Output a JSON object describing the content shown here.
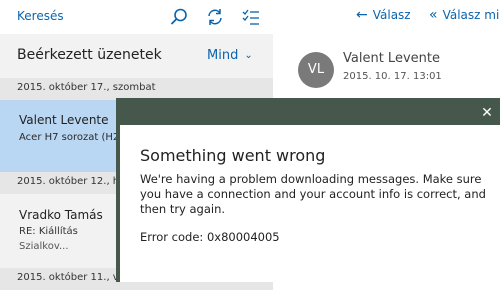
{
  "toolbar": {
    "search_label": "Keresés",
    "icons": [
      "search-icon",
      "sync-icon",
      "select-mode-icon"
    ]
  },
  "folder": {
    "title": "Beérkezett üzenetek",
    "filter_label": "Mind"
  },
  "message_list": {
    "groups": [
      {
        "date": "2015. október 17., szombat",
        "items": [
          {
            "sender": "Valent Levente",
            "subject": "Acer H7 sorozat (H2...",
            "preview": "",
            "selected": true
          }
        ]
      },
      {
        "date": "2015. október 12., hé...",
        "items": [
          {
            "sender": "Vradko Tamás",
            "subject": "RE: Kiállítás",
            "preview": "Szialkov...",
            "selected": false
          }
        ]
      },
      {
        "date": "2015. október 11., va...",
        "items": []
      }
    ]
  },
  "reading_pane": {
    "reply_label": "Válasz",
    "reply_all_label": "Válasz min",
    "avatar_initials": "VL",
    "from_name": "Valent Levente",
    "from_date": "2015. 10. 17. 13:01"
  },
  "dialog": {
    "title": "Something went wrong",
    "body": "We're having a problem downloading messages. Make sure you have a connection and your account info is correct, and then try again.",
    "error_code": "Error code: 0x80004005",
    "close_glyph": "✕"
  },
  "colors": {
    "accent": "#0a64ad",
    "selected_item": "#b9d6f2",
    "dialog_scrim": "#46584c"
  }
}
